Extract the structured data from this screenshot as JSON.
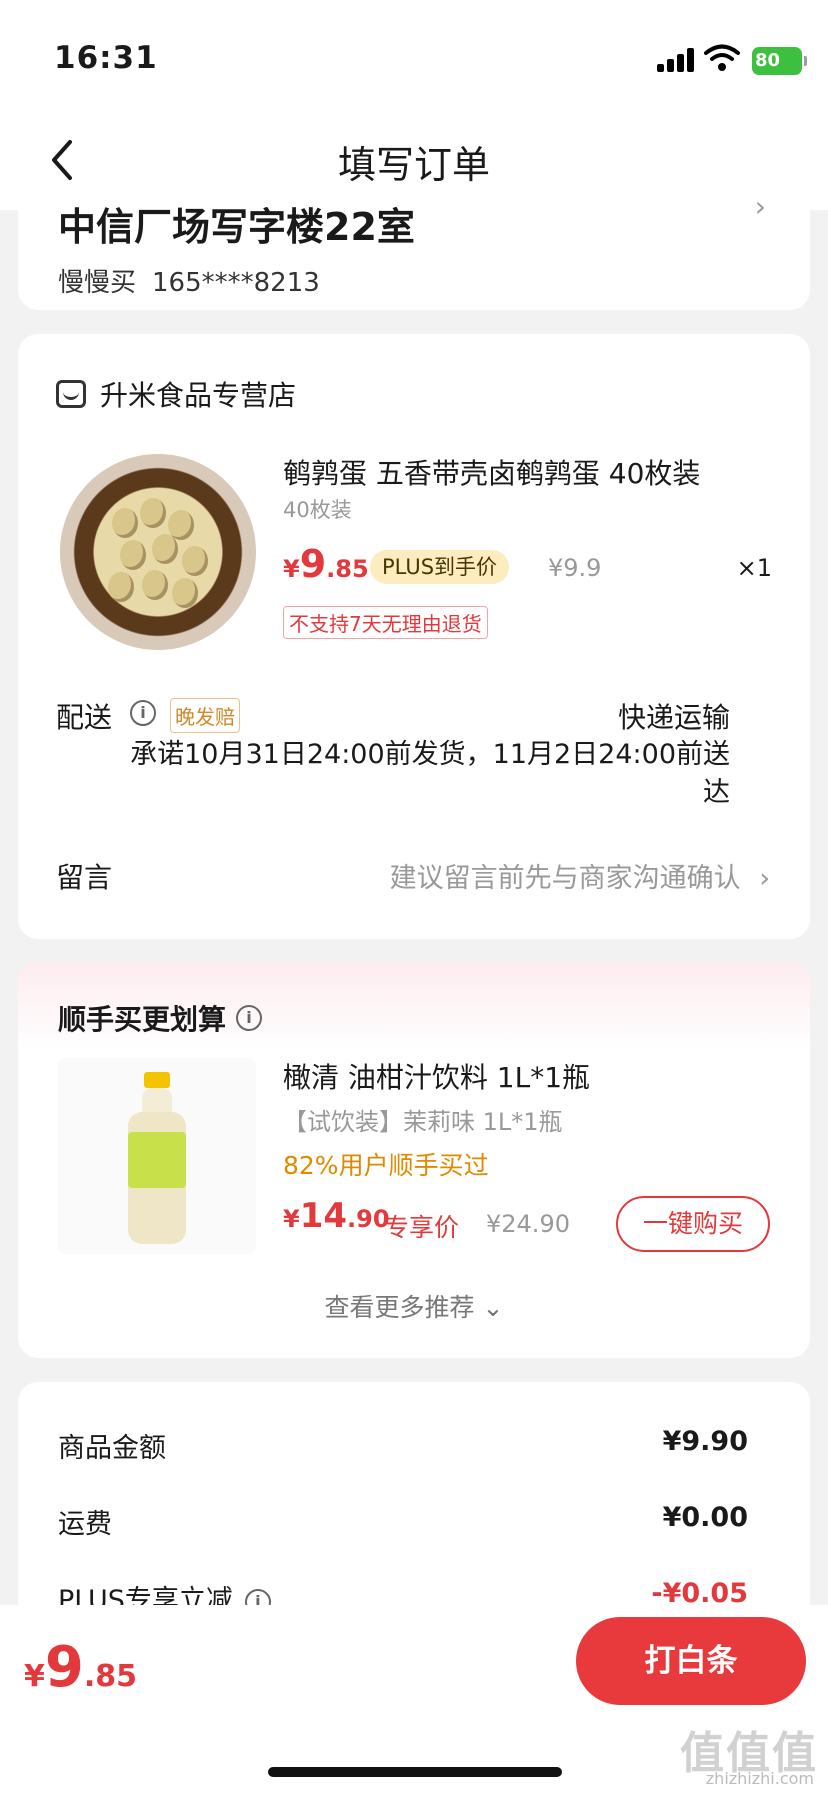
{
  "status_bar": {
    "time": "16:31",
    "battery": "80"
  },
  "nav": {
    "title": "填写订单",
    "back_icon": "chevron-left-icon"
  },
  "address": {
    "line": "中信厂场写字楼22室",
    "name": "慢慢买",
    "phone": "165****8213"
  },
  "shop": {
    "name": "升米食品专营店",
    "product": {
      "title": "鹌鹑蛋 五香带壳卤鹌鹑蛋 40枚装",
      "spec": "40枚装",
      "currency": "¥",
      "price_int": "9",
      "price_dec": ".85",
      "plus_tag": "PLUS到手价",
      "orig_price": "¥9.9",
      "qty": "×1",
      "return_tag": "不支持7天无理由退货"
    },
    "shipping": {
      "label": "配送",
      "late_tag": "晚发赔",
      "type": "快递运输",
      "promise": "承诺10月31日24:00前发货，11月2日24:00前送达"
    },
    "message": {
      "label": "留言",
      "hint": "建议留言前先与商家沟通确认",
      "chevron": "›"
    }
  },
  "deal": {
    "title": "顺手买更划算",
    "product": {
      "title": "橄清 油柑汁饮料 1L*1瓶",
      "spec": "【试饮装】茉莉味 1L*1瓶",
      "rate": "82%用户顺手买过",
      "currency": "¥",
      "price_int": "14",
      "price_dec": ".90",
      "excl_label": "专享价",
      "orig_price": "¥24.90",
      "buy_label": "一键购买"
    },
    "more_label": "查看更多推荐 ⌄"
  },
  "summary": [
    {
      "label": "商品金额",
      "value": "¥9.90"
    },
    {
      "label": "运费",
      "value": "¥0.00"
    },
    {
      "label": "PLUS专享立减",
      "value": "-¥0.05"
    }
  ],
  "footer": {
    "currency": "¥",
    "price_int": "9",
    "price_dec": ".85",
    "pay_label": "打白条"
  },
  "watermark": {
    "main": "值值值",
    "sub": "zhizhizhi.com"
  },
  "colors": {
    "accent": "#e4393c",
    "plus_tag_bg": "#fcecc0",
    "rate": "#e08a00"
  }
}
